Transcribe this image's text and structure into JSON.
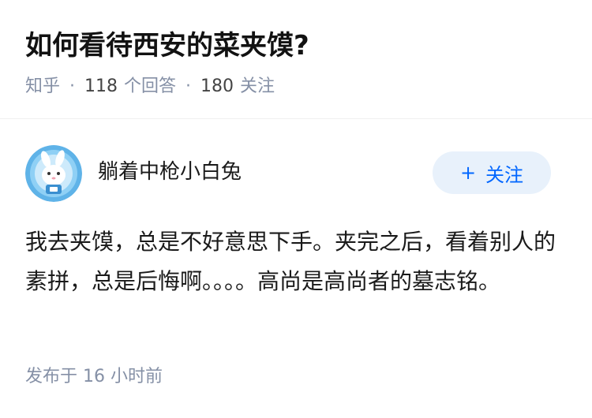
{
  "question": {
    "title": "如何看待西安的菜夹馍?",
    "source": "知乎",
    "separator": "·",
    "answers_count": "118",
    "answers_label": "个回答",
    "followers_count": "180",
    "followers_label": "关注"
  },
  "answer": {
    "author_name": "躺着中枪小白兔",
    "follow_plus": "+",
    "follow_label": "关注",
    "content": "我去夹馍，总是不好意思下手。夹完之后，看着别人的素拼，总是后悔啊。。。。高尚是高尚者的墓志铭。",
    "time": "发布于 16 小时前"
  },
  "colors": {
    "accent": "#0066ff",
    "follow_bg": "#e8f1fb",
    "meta_gray": "#8590a6"
  },
  "icons": {
    "avatar": "bunny-astronaut-avatar"
  }
}
